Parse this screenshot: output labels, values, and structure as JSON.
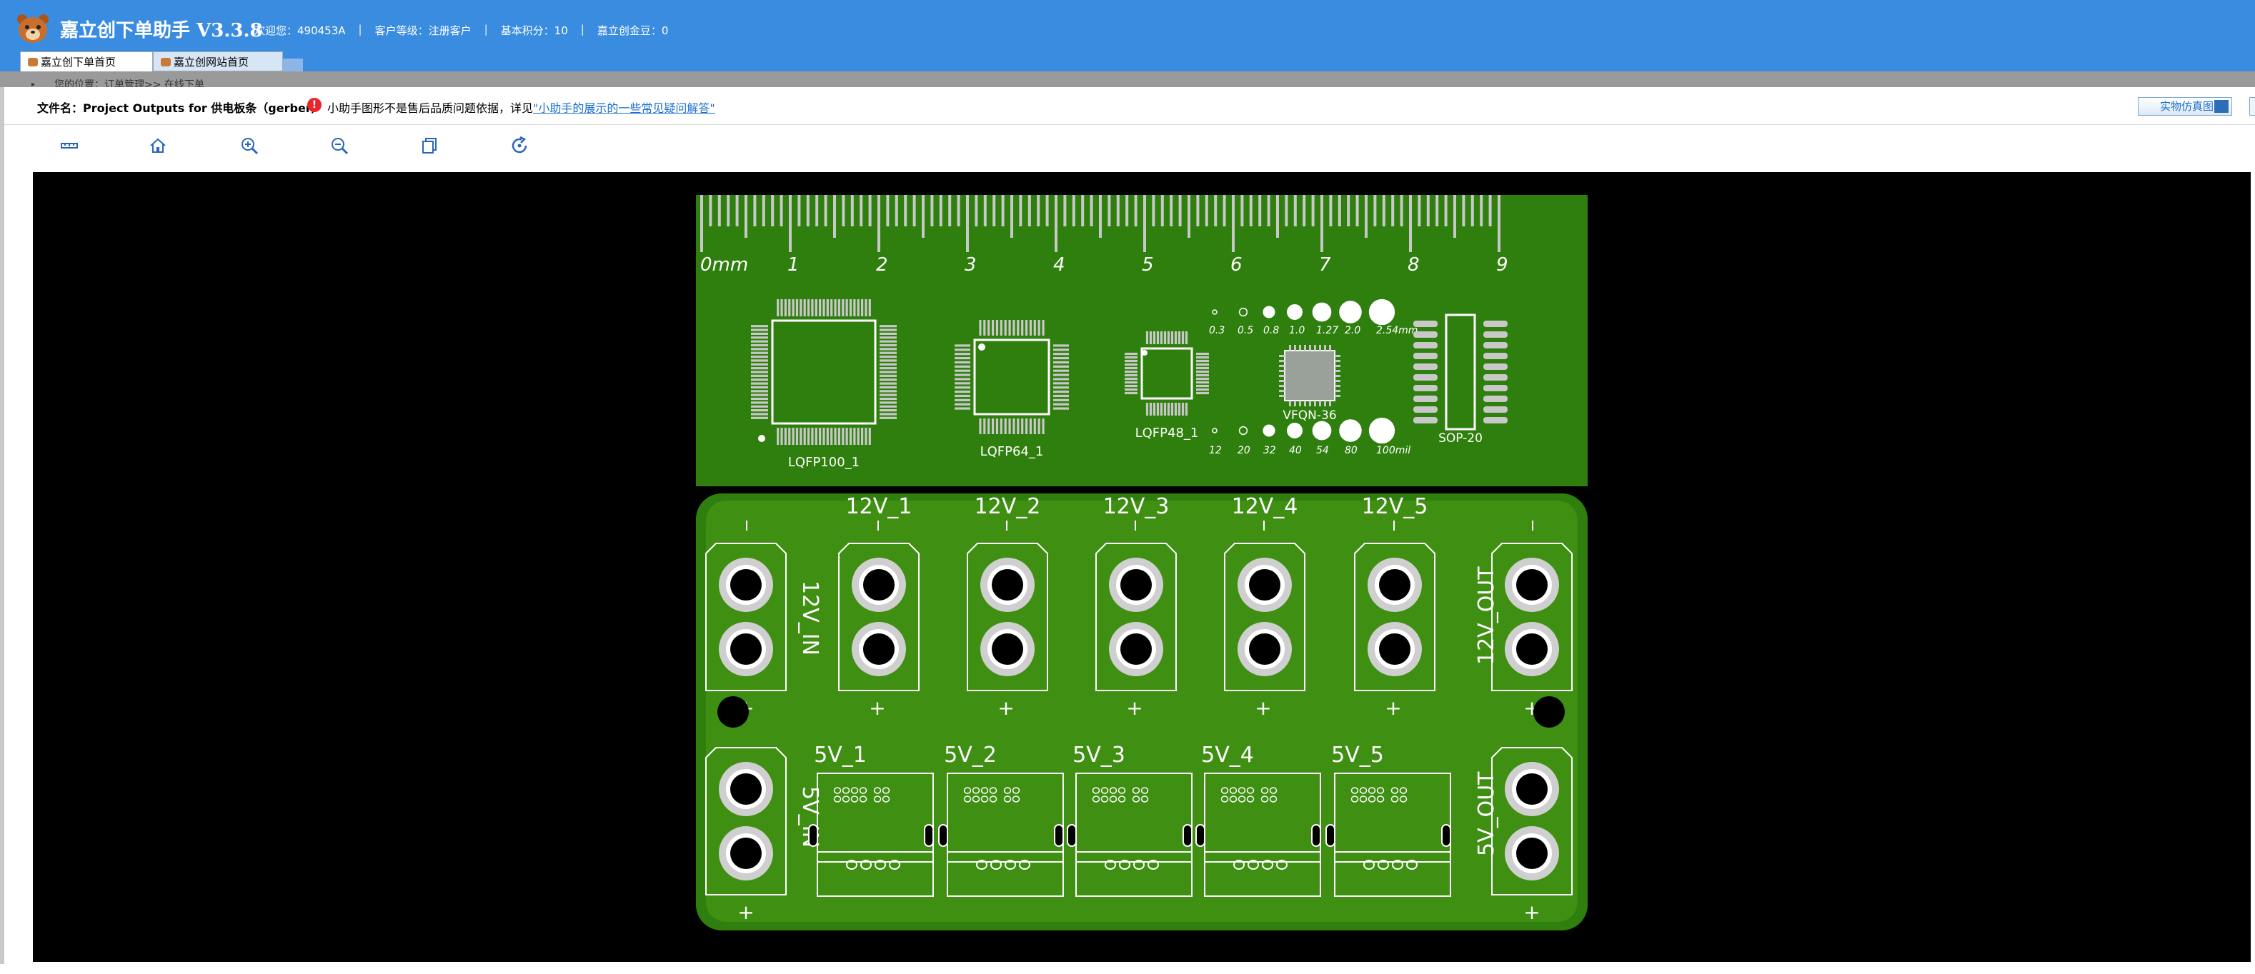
{
  "app": {
    "title": "嘉立创下单助手 V3.3.8",
    "welcome": "欢迎您：490453A",
    "level": "客户等级：注册客户",
    "points": "基本积分：10",
    "gold": "嘉立创金豆：0",
    "sep": "|"
  },
  "tabs": [
    {
      "label": "嘉立创下单首页",
      "active": true
    },
    {
      "label": "嘉立创网站首页",
      "active": false
    }
  ],
  "breadcrumb": "您的位置：订单管理>> 在线下单",
  "file": {
    "label": "文件名：Project Outputs for 供电板条（gerber）",
    "note_prefix": "小助手图形不是售后品质问题依据，详见",
    "note_link": "\"小助手的展示的一些常见疑问解答\"",
    "real_button": "实物仿真图"
  },
  "toolbar": {
    "icons": [
      "measure-icon",
      "home-icon",
      "zoom-in-icon",
      "zoom-out-icon",
      "copy-icon",
      "refresh-icon"
    ]
  },
  "pcb": {
    "board_color": "#2f7f0e",
    "silk_color": "#ffffff",
    "ruler_numbers": [
      "0mm",
      "1",
      "2",
      "3",
      "4",
      "5",
      "6",
      "7",
      "8",
      "9"
    ],
    "packages": [
      "LQFP100_1",
      "LQFP64_1",
      "LQFP48_1",
      "VFQN-36",
      "SOP-20"
    ],
    "pitch_top": [
      "0.3",
      "0.5",
      "0.8",
      "1.0",
      "1.27",
      "2.0",
      "2.54mm"
    ],
    "pitch_bottom": [
      "12",
      "20",
      "32",
      "40",
      "54",
      "80",
      "100mil"
    ],
    "labels_12v": [
      "12V_1",
      "12V_2",
      "12V_3",
      "12V_4",
      "12V_5"
    ],
    "labels_5v": [
      "5V_1",
      "5V_2",
      "5V_3",
      "5V_4",
      "5V_5"
    ],
    "in_12v": "12V_IN",
    "out_12v": "12V_OUT",
    "in_5v": "5V_IN",
    "out_5v": "5V_OUT",
    "plus": "+"
  }
}
